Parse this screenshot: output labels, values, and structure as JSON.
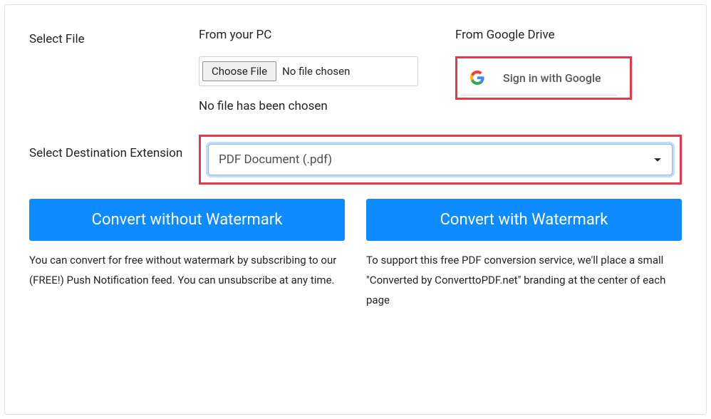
{
  "labels": {
    "select_file": "Select File",
    "select_dest": "Select Destination Extension"
  },
  "pc": {
    "title": "From your PC",
    "choose_btn": "Choose File",
    "chosen_status": "No file chosen",
    "no_file_msg": "No file has been chosen"
  },
  "drive": {
    "title": "From Google Drive",
    "signin": "Sign in with Google"
  },
  "dest": {
    "selected": "PDF Document (.pdf)"
  },
  "convert": {
    "without": {
      "button": "Convert without Watermark",
      "desc": "You can convert for free without watermark by subscribing to our (FREE!) Push Notification feed. You can unsubscribe at any time."
    },
    "with": {
      "button": "Convert with Watermark",
      "desc": "To support this free PDF conversion service, we'll place a small \"Converted by ConverttoPDF.net\" branding at the center of each page"
    }
  }
}
